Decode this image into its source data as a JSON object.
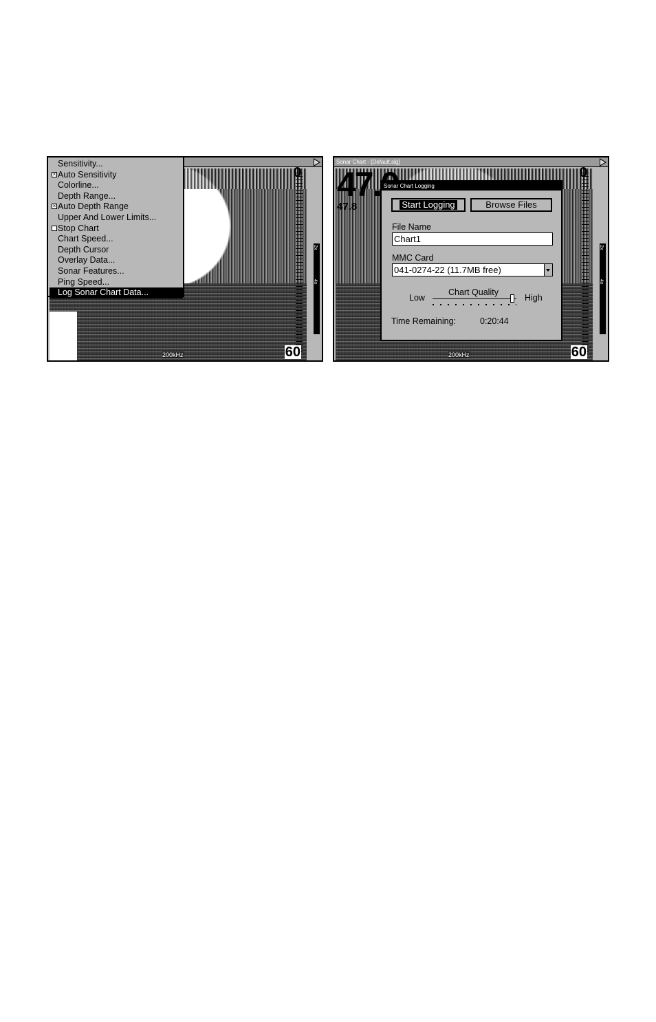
{
  "left_screen": {
    "menu": {
      "items": [
        {
          "label": "Sensitivity...",
          "checkbox": null,
          "selected": false
        },
        {
          "label": "Auto Sensitivity",
          "checkbox": "checked",
          "selected": false
        },
        {
          "label": "Colorline...",
          "checkbox": null,
          "selected": false
        },
        {
          "label": "Depth Range...",
          "checkbox": null,
          "selected": false
        },
        {
          "label": "Auto Depth Range",
          "checkbox": "checked",
          "selected": false
        },
        {
          "label": "Upper And Lower Limits...",
          "checkbox": null,
          "selected": false
        },
        {
          "label": "Stop Chart",
          "checkbox": "unchecked",
          "selected": false
        },
        {
          "label": "Chart Speed...",
          "checkbox": null,
          "selected": false
        },
        {
          "label": "Depth Cursor",
          "checkbox": null,
          "selected": false
        },
        {
          "label": "Overlay Data...",
          "checkbox": null,
          "selected": false
        },
        {
          "label": "Sonar Features...",
          "checkbox": null,
          "selected": false
        },
        {
          "label": "Ping Speed...",
          "checkbox": null,
          "selected": false
        },
        {
          "label": "Log Sonar Chart Data...",
          "checkbox": null,
          "selected": true
        }
      ]
    },
    "depth_top": "0",
    "depth_bottom": "60",
    "frequency": "200kHz",
    "zoom_2x": "2x",
    "zoom_4x": "4x"
  },
  "right_screen": {
    "title": "Sonar Chart - [Default.slg]",
    "big_depth": "47.0",
    "small_depth": "47.8",
    "depth_top": "0",
    "depth_bottom": "60",
    "frequency": "200kHz",
    "zoom_2x": "2x",
    "zoom_4x": "4x",
    "dialog": {
      "title": "Sonar Chart Logging",
      "start_button": "Start Logging",
      "browse_button": "Browse Files",
      "file_name_label": "File Name",
      "file_name_value": "Chart1",
      "mmc_label": "MMC Card",
      "mmc_value": "041-0274-22 (11.7MB free)",
      "quality_label": "Chart Quality",
      "quality_low": "Low",
      "quality_high": "High",
      "quality_level": 0.95,
      "time_label": "Time Remaining:",
      "time_value": "0:20:44"
    }
  }
}
